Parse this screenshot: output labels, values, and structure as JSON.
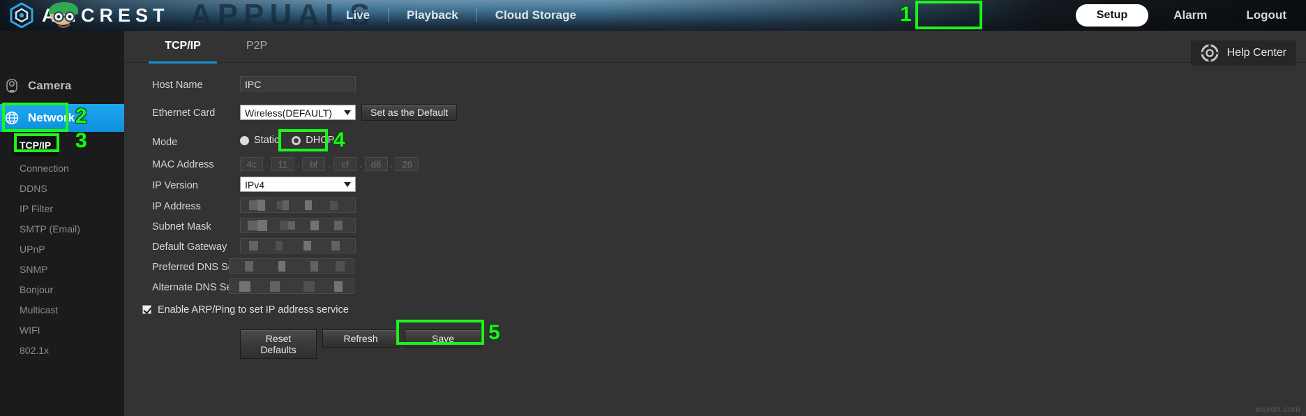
{
  "brand": {
    "name": "AMCREST",
    "logo_icon": "amcrest-hexagon-logo"
  },
  "watermarks": {
    "appuals": "APPUALS",
    "bottom_right": "wsxdn.com"
  },
  "topnav": {
    "items": [
      {
        "label": "Live",
        "name": "live"
      },
      {
        "label": "Playback",
        "name": "playback"
      },
      {
        "label": "Cloud Storage",
        "name": "cloud-storage"
      }
    ],
    "right_items": [
      {
        "label": "Setup",
        "name": "setup",
        "active": true
      },
      {
        "label": "Alarm",
        "name": "alarm",
        "active": false
      },
      {
        "label": "Logout",
        "name": "logout",
        "active": false
      }
    ]
  },
  "help": {
    "label": "Help Center",
    "icon": "lifebuoy-icon"
  },
  "sidebar": {
    "groups": [
      {
        "label": "Camera",
        "icon": "camera-icon",
        "active": false
      },
      {
        "label": "Network",
        "icon": "network-globe-icon",
        "active": true
      }
    ],
    "network_items": [
      {
        "label": "TCP/IP",
        "active": true
      },
      {
        "label": "Connection",
        "active": false
      },
      {
        "label": "DDNS",
        "active": false
      },
      {
        "label": "IP Filter",
        "active": false
      },
      {
        "label": "SMTP (Email)",
        "active": false
      },
      {
        "label": "UPnP",
        "active": false
      },
      {
        "label": "SNMP",
        "active": false
      },
      {
        "label": "Bonjour",
        "active": false
      },
      {
        "label": "Multicast",
        "active": false
      },
      {
        "label": "WIFI",
        "active": false
      },
      {
        "label": "802.1x",
        "active": false
      }
    ]
  },
  "tabs": [
    {
      "label": "TCP/IP",
      "active": true
    },
    {
      "label": "P2P",
      "active": false
    }
  ],
  "form": {
    "host_name": {
      "label": "Host Name",
      "value": "IPC"
    },
    "ethernet_card": {
      "label": "Ethernet Card",
      "value": "Wireless(DEFAULT)",
      "set_default_button": "Set as the Default"
    },
    "mode": {
      "label": "Mode",
      "static_label": "Static",
      "dhcp_label": "DHCP",
      "selected": "DHCP"
    },
    "mac_address": {
      "label": "MAC Address",
      "octets": [
        "4c",
        "11",
        "bf",
        "cf",
        "d6",
        "26"
      ],
      "separator": "."
    },
    "ip_version": {
      "label": "IP Version",
      "value": "IPv4"
    },
    "ip_address": {
      "label": "IP Address",
      "value": ""
    },
    "subnet_mask": {
      "label": "Subnet Mask",
      "value": ""
    },
    "default_gateway": {
      "label": "Default Gateway",
      "value": ""
    },
    "preferred_dns": {
      "label": "Preferred DNS Server",
      "value": ""
    },
    "alternate_dns": {
      "label": "Alternate DNS Server",
      "value": ""
    },
    "arp_ping": {
      "label": "Enable ARP/Ping to set IP address service",
      "checked": true
    },
    "buttons": {
      "reset": "Reset Defaults",
      "refresh": "Refresh",
      "save": "Save"
    }
  },
  "annotations": [
    {
      "number": "1",
      "target": "setup-button"
    },
    {
      "number": "2",
      "target": "sidebar-network"
    },
    {
      "number": "3",
      "target": "sidebar-tcpip"
    },
    {
      "number": "4",
      "target": "dhcp-radio"
    },
    {
      "number": "5",
      "target": "save-button"
    }
  ],
  "colors": {
    "annotation_green": "#1cf51c",
    "accent_blue": "#1790d8",
    "sidebar_active": "#1ea8f0"
  }
}
